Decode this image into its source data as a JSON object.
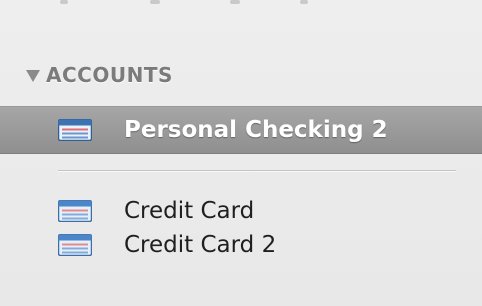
{
  "sidebar": {
    "section": {
      "title": "ACCOUNTS",
      "expanded": true
    },
    "selected_item": {
      "label": "Personal Checking 2",
      "icon": "checking-account-icon"
    },
    "items": [
      {
        "label": "Credit Card",
        "icon": "credit-card-icon"
      },
      {
        "label": "Credit Card 2",
        "icon": "credit-card-icon"
      }
    ]
  },
  "colors": {
    "selection_background": "#999999",
    "section_header_text": "#7b7b7b",
    "item_text": "#1f1f1f",
    "selected_text": "#ffffff"
  }
}
